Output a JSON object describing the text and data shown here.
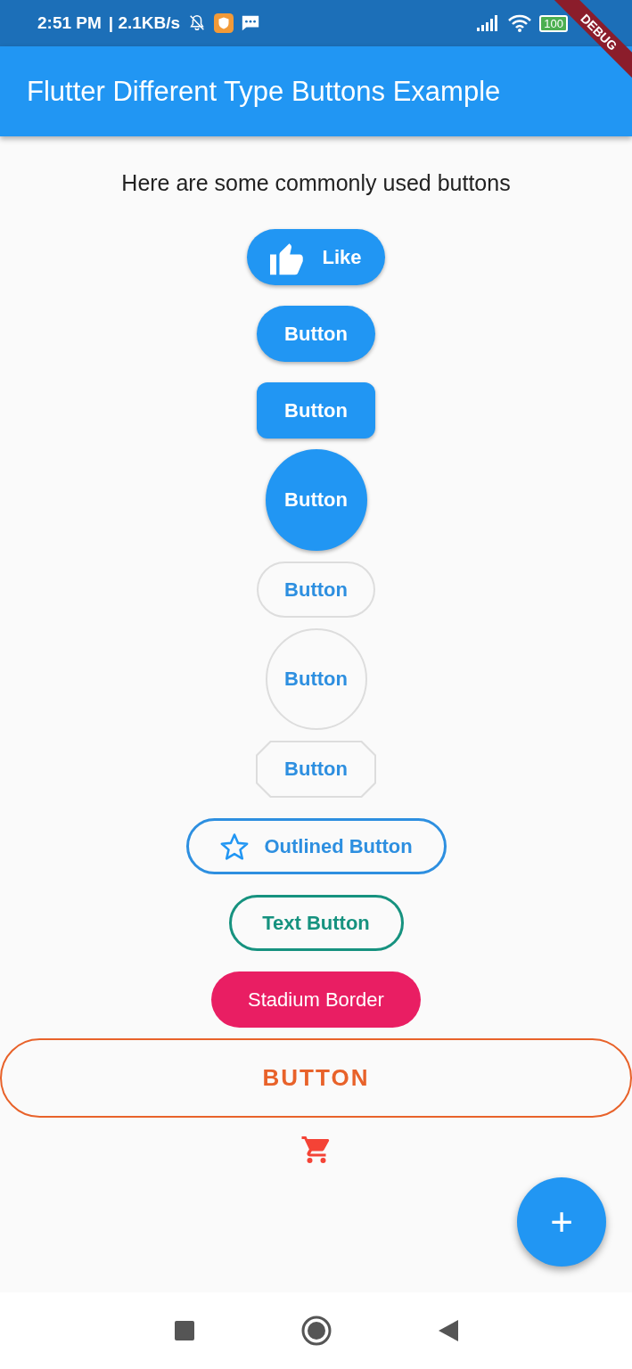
{
  "status_bar": {
    "time": "2:51 PM",
    "speed": "| 2.1KB/s",
    "battery": "100"
  },
  "debug_banner": "DEBUG",
  "app_bar": {
    "title": "Flutter Different Type Buttons Example"
  },
  "heading": "Here are some commonly used buttons",
  "buttons": [
    {
      "kind": "like",
      "label": "Like"
    },
    {
      "kind": "stadium-filled",
      "label": "Button"
    },
    {
      "kind": "rounded-filled",
      "label": "Button"
    },
    {
      "kind": "circle-filled",
      "label": "Button"
    },
    {
      "kind": "stadium-outline",
      "label": "Button"
    },
    {
      "kind": "circle-outline",
      "label": "Button"
    },
    {
      "kind": "bevel-outline",
      "label": "Button"
    },
    {
      "kind": "star-outline",
      "label": "Outlined Button"
    },
    {
      "kind": "text-outline",
      "label": "Text Button"
    },
    {
      "kind": "stadium-pink",
      "label": "Stadium Border"
    },
    {
      "kind": "wide-outline",
      "label": "BUTTON"
    },
    {
      "kind": "cart"
    }
  ],
  "fab": {
    "label": "+"
  }
}
